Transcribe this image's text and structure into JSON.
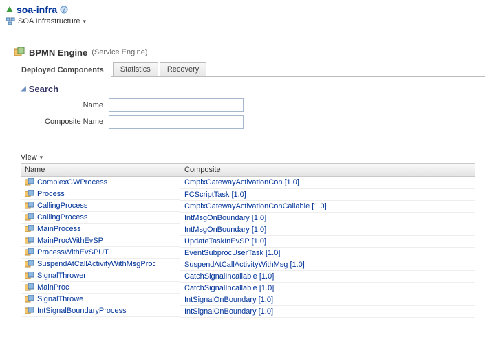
{
  "header": {
    "title": "soa-infra",
    "subtitle": "SOA Infrastructure"
  },
  "engine": {
    "title": "BPMN Engine",
    "type": "(Service Engine)"
  },
  "tabs": [
    {
      "label": "Deployed Components",
      "active": true
    },
    {
      "label": "Statistics",
      "active": false
    },
    {
      "label": "Recovery",
      "active": false
    }
  ],
  "search": {
    "heading": "Search",
    "name_label": "Name",
    "composite_label": "Composite Name",
    "name_value": "",
    "composite_value": ""
  },
  "view_menu": "View",
  "columns": {
    "name": "Name",
    "composite": "Composite"
  },
  "rows": [
    {
      "name": "ComplexGWProcess",
      "composite": "CmplxGatewayActivationCon [1.0]"
    },
    {
      "name": "Process",
      "composite": "FCScriptTask [1.0]"
    },
    {
      "name": "CallingProcess",
      "composite": "CmplxGatewayActivationConCallable [1.0]"
    },
    {
      "name": "CallingProcess",
      "composite": "IntMsgOnBoundary [1.0]"
    },
    {
      "name": "MainProcess",
      "composite": "IntMsgOnBoundary [1.0]"
    },
    {
      "name": "MainProcWithEvSP",
      "composite": "UpdateTaskInEvSP [1.0]"
    },
    {
      "name": "ProcessWithEvSPUT",
      "composite": "EventSubprocUserTask [1.0]"
    },
    {
      "name": "SuspendAtCallActivityWithMsgProc",
      "composite": "SuspendAtCallActivityWithMsg [1.0]"
    },
    {
      "name": "SignalThrower",
      "composite": "CatchSignalIncallable [1.0]"
    },
    {
      "name": "MainProc",
      "composite": "CatchSignalIncallable [1.0]"
    },
    {
      "name": "SignalThrowe",
      "composite": "IntSignalOnBoundary [1.0]"
    },
    {
      "name": "IntSignalBoundaryProcess",
      "composite": "IntSignalOnBoundary [1.0]"
    }
  ]
}
